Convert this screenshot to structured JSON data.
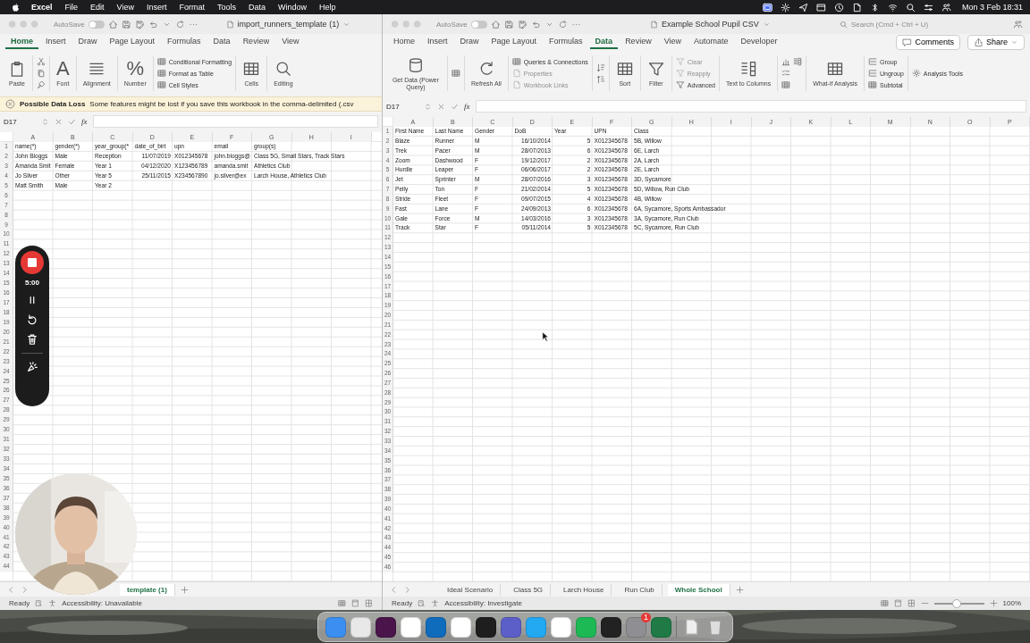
{
  "menu_bar": {
    "app": "Excel",
    "items": [
      "File",
      "Edit",
      "View",
      "Insert",
      "Format",
      "Tools",
      "Data",
      "Window",
      "Help"
    ],
    "clock": "Mon 3 Feb 18:31"
  },
  "left_window": {
    "autosave_label": "AutoSave",
    "autosave_on": false,
    "title": "import_runners_template (1)",
    "tabs": [
      {
        "label": "Home",
        "selected": true
      },
      {
        "label": "Insert",
        "selected": false
      },
      {
        "label": "Draw",
        "selected": false
      },
      {
        "label": "Page Layout",
        "selected": false
      },
      {
        "label": "Formulas",
        "selected": false
      },
      {
        "label": "Data",
        "selected": false
      },
      {
        "label": "Review",
        "selected": false
      },
      {
        "label": "View",
        "selected": false
      }
    ],
    "ribbon": [
      {
        "kind": "large",
        "label": "Paste"
      },
      {
        "kind": "icons"
      },
      {
        "kind": "glyph",
        "glyph": "A",
        "label": "Font"
      },
      {
        "kind": "large",
        "label": "Alignment"
      },
      {
        "kind": "glyph",
        "glyph": "%",
        "label": "Number"
      },
      {
        "kind": "stack",
        "items": [
          {
            "label": "Conditional Formatting",
            "disabled": false
          },
          {
            "label": "Format as Table",
            "disabled": false
          },
          {
            "label": "Cell Styles",
            "disabled": false
          }
        ]
      },
      {
        "kind": "large",
        "label": "Cells"
      },
      {
        "kind": "large",
        "label": "Editing"
      }
    ],
    "warning": {
      "title": "Possible Data Loss",
      "message": "Some features might be lost if you save this workbook in the comma-delimited (.csv"
    },
    "name_box": "D17",
    "fx": "fx",
    "sheet": {
      "columns": [
        {
          "letter": "A",
          "numeric": false
        },
        {
          "letter": "B",
          "numeric": false
        },
        {
          "letter": "C",
          "numeric": false
        },
        {
          "letter": "D",
          "numeric": true
        },
        {
          "letter": "E",
          "numeric": false
        },
        {
          "letter": "F",
          "numeric": false
        },
        {
          "letter": "G",
          "numeric": false
        },
        {
          "letter": "H"
        },
        {
          "letter": "I"
        }
      ],
      "row_numbers": [
        "1",
        "2",
        "3",
        "4",
        "5",
        "6",
        "7",
        "8",
        "9",
        "10",
        "11",
        "12",
        "13",
        "14",
        "15",
        "16",
        "17",
        "18",
        "19",
        "20",
        "21",
        "22",
        "23",
        "24",
        "25",
        "26",
        "27",
        "28",
        "29",
        "30",
        "31",
        "32",
        "33",
        "34",
        "35",
        "36",
        "37",
        "38",
        "39",
        "40",
        "41",
        "42",
        "43",
        "44"
      ],
      "rows": [
        [
          "name(*)",
          "gender(*)",
          "year_group(*",
          "date_of_birt",
          "upn",
          "email",
          "group(s)"
        ],
        [
          "John Bloggs",
          "Male",
          "Reception",
          "11/07/2019",
          "X012345678",
          "john.bloggs@",
          "Class 5G, Small Stars, Track Stars"
        ],
        [
          "Amanda Smit",
          "Female",
          "Year 1",
          "04/12/2020",
          "X123456789",
          "amanda.smit",
          "Athletics Club"
        ],
        [
          "Jo Silver",
          "Other",
          "Year 5",
          "25/11/2015",
          "X234567890",
          "jo.silver@ex",
          "Larch House, Athletics Club"
        ],
        [
          "Matt Smith",
          "Male",
          "Year 2"
        ]
      ]
    },
    "sheet_tabs": [
      {
        "label": "template (1)",
        "selected": true
      }
    ],
    "status": "Ready",
    "accessibility": "Accessibility: Unavailable"
  },
  "right_window": {
    "autosave_label": "AutoSave",
    "autosave_on": false,
    "title": "Example School Pupil CSV",
    "search_placeholder": "Search (Cmd + Ctrl + U)",
    "tabs": [
      {
        "label": "Home",
        "selected": false
      },
      {
        "label": "Insert",
        "selected": false
      },
      {
        "label": "Draw",
        "selected": false
      },
      {
        "label": "Page Layout",
        "selected": false
      },
      {
        "label": "Formulas",
        "selected": false
      },
      {
        "label": "Data",
        "selected": true
      },
      {
        "label": "Review",
        "selected": false
      },
      {
        "label": "View",
        "selected": false
      },
      {
        "label": "Automate",
        "selected": false
      },
      {
        "label": "Developer",
        "selected": false
      }
    ],
    "comments_button": "Comments",
    "share_button": "Share",
    "ribbon": [
      {
        "kind": "large",
        "label": "Get Data (Power Query)"
      },
      {
        "kind": "icons"
      },
      {
        "kind": "large",
        "label": "Refresh All"
      },
      {
        "kind": "stack",
        "items": [
          {
            "label": "Queries & Connections",
            "disabled": false
          },
          {
            "label": "Properties",
            "disabled": true
          },
          {
            "label": "Workbook Links",
            "disabled": true
          }
        ]
      },
      {
        "kind": "icons"
      },
      {
        "kind": "large",
        "label": "Sort"
      },
      {
        "kind": "large",
        "label": "Filter"
      },
      {
        "kind": "stack",
        "items": [
          {
            "label": "Clear",
            "disabled": true
          },
          {
            "label": "Reapply",
            "disabled": true
          },
          {
            "label": "Advanced",
            "disabled": false
          }
        ]
      },
      {
        "kind": "large",
        "label": "Text to Columns"
      },
      {
        "kind": "icons"
      },
      {
        "kind": "large",
        "label": "What-if Analysis"
      },
      {
        "kind": "stack",
        "items": [
          {
            "label": "Group",
            "disabled": false
          },
          {
            "label": "Ungroup",
            "disabled": false
          },
          {
            "label": "Subtotal",
            "disabled": false
          }
        ]
      },
      {
        "kind": "stack",
        "items": [
          {
            "label": "Analysis Tools",
            "disabled": false
          }
        ]
      }
    ],
    "name_box": "D17",
    "fx": "fx",
    "sheet": {
      "columns": [
        {
          "letter": "A",
          "numeric": false
        },
        {
          "letter": "B",
          "numeric": false
        },
        {
          "letter": "C",
          "numeric": false
        },
        {
          "letter": "D",
          "numeric": true
        },
        {
          "letter": "E",
          "numeric": true
        },
        {
          "letter": "F",
          "numeric": false
        },
        {
          "letter": "G",
          "numeric": false
        },
        {
          "letter": "H"
        },
        {
          "letter": "I"
        },
        {
          "letter": "J"
        },
        {
          "letter": "K"
        },
        {
          "letter": "L"
        },
        {
          "letter": "M"
        },
        {
          "letter": "N"
        },
        {
          "letter": "O"
        },
        {
          "letter": "P"
        }
      ],
      "row_numbers": [
        "1",
        "2",
        "3",
        "4",
        "5",
        "6",
        "7",
        "8",
        "9",
        "10",
        "11",
        "12",
        "13",
        "14",
        "15",
        "16",
        "17",
        "18",
        "19",
        "20",
        "21",
        "22",
        "23",
        "24",
        "25",
        "26",
        "27",
        "28",
        "29",
        "30",
        "31",
        "32",
        "33",
        "34",
        "35",
        "36",
        "37",
        "38",
        "39",
        "40",
        "41",
        "42",
        "43",
        "44",
        "45",
        "46"
      ],
      "rows": [
        [
          "First Name",
          "Last Name",
          "Gender",
          "DoB",
          "Year",
          "UPN",
          "Class"
        ],
        [
          "Blaze",
          "Runner",
          "M",
          "16/10/2014",
          "5",
          "X012345678",
          "5B, Willow"
        ],
        [
          "Trek",
          "Pacer",
          "M",
          "28/07/2013",
          "6",
          "X012345678",
          "6E, Larch"
        ],
        [
          "Zoom",
          "Dashwood",
          "F",
          "19/12/2017",
          "2",
          "X012345678",
          "2A, Larch"
        ],
        [
          "Hurdle",
          "Leaper",
          "F",
          "06/06/2017",
          "2",
          "X012345678",
          "2E, Larch"
        ],
        [
          "Jet",
          "Sprinter",
          "M",
          "28/07/2016",
          "3",
          "X012345678",
          "3D, Sycamore"
        ],
        [
          "Pelly",
          "Ton",
          "F",
          "21/02/2014",
          "5",
          "X012345678",
          "5D, Willow, Run Club"
        ],
        [
          "Stride",
          "Fleet",
          "F",
          "09/07/2015",
          "4",
          "X012345678",
          "4B, Willow"
        ],
        [
          "Fast",
          "Lane",
          "F",
          "24/09/2013",
          "6",
          "X012345678",
          "6A, Sycamore, Sports Ambassador"
        ],
        [
          "Gale",
          "Force",
          "M",
          "14/03/2016",
          "3",
          "X012345678",
          "3A, Sycamore, Run Club"
        ],
        [
          "Track",
          "Star",
          "F",
          "05/11/2014",
          "5",
          "X012345678",
          "5C, Sycamore, Run Club"
        ]
      ]
    },
    "sheet_tabs": [
      {
        "label": "Ideal Scenario",
        "selected": false
      },
      {
        "label": "Class 5G",
        "selected": false
      },
      {
        "label": "Larch House",
        "selected": false
      },
      {
        "label": "Run Club",
        "selected": false
      },
      {
        "label": "Whole School",
        "selected": true
      }
    ],
    "status": "Ready",
    "accessibility": "Accessibility: Investigate",
    "zoom": {
      "level": 0.45,
      "reading": "100%"
    }
  },
  "recorder": {
    "time": "5:00"
  },
  "dock": {
    "badge": "1"
  }
}
